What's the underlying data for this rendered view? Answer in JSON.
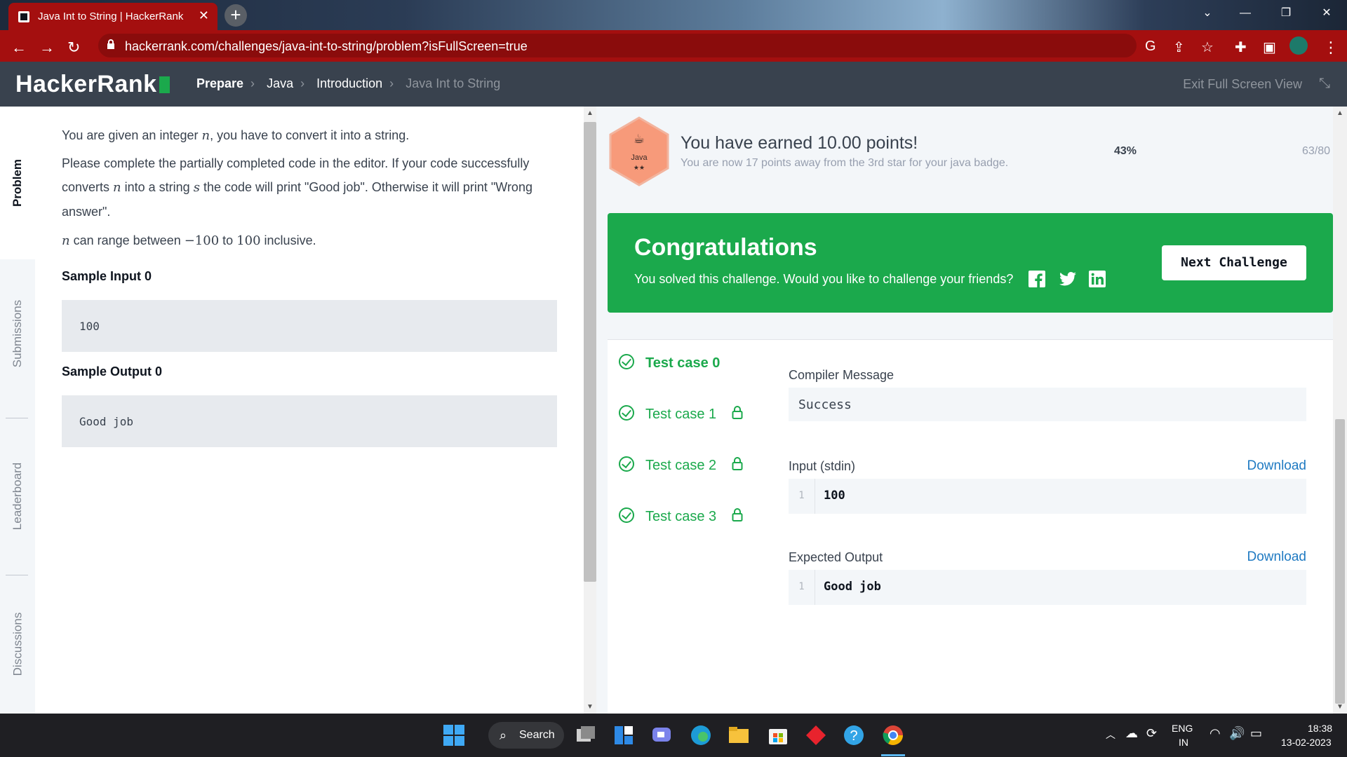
{
  "browser": {
    "tab_title": "Java Int to String | HackerRank",
    "url": "hackerrank.com/challenges/java-int-to-string/problem?isFullScreen=true",
    "tab_color": "#a40f0f"
  },
  "header": {
    "logo": "HackerRank",
    "breadcrumbs": [
      "Prepare",
      "Java",
      "Introduction",
      "Java Int to String"
    ],
    "exit_fullscreen": "Exit Full Screen View"
  },
  "sidebar": {
    "tabs": [
      "Problem",
      "Submissions",
      "Leaderboard",
      "Discussions"
    ],
    "active": "Problem"
  },
  "problem": {
    "line1_a": "You are given an integer ",
    "var_n": "n",
    "line1_b": ", you have to convert it into a string.",
    "line2_a": "Please complete the partially completed code in the editor. If your code successfully converts ",
    "line2_b": " into a string ",
    "var_s": "s",
    "line2_c": " the code will print \"Good job\". Otherwise it will print \"Wrong answer\".",
    "line3_a": " can range between ",
    "range_low": "−100",
    "line3_b": " to ",
    "range_high": "100",
    "line3_c": " inclusive.",
    "sample_input_title": "Sample Input 0",
    "sample_input": "100",
    "sample_output_title": "Sample Output 0",
    "sample_output": "Good job"
  },
  "achievement": {
    "badge_label": "Java",
    "badge_stars": "★★",
    "earned": "You have earned 10.00 points!",
    "away": "You are now 17 points away from the 3rd star for your java badge.",
    "percent": "43%",
    "progress_value": 0.43,
    "fraction": "63/80"
  },
  "congrats": {
    "title": "Congratulations",
    "subtitle": "You solved this challenge. Would you like to challenge your friends?",
    "next_button": "Next Challenge",
    "social": [
      "facebook-icon",
      "twitter-icon",
      "linkedin-icon"
    ]
  },
  "results": {
    "test_cases": [
      "Test case 0",
      "Test case 1",
      "Test case 2",
      "Test case 3"
    ],
    "compiler_label": "Compiler Message",
    "compiler_message": "Success",
    "input_label": "Input (stdin)",
    "input_line_no": "1",
    "input_value": "100",
    "expected_label": "Expected Output",
    "expected_line_no": "1",
    "expected_value": "Good job",
    "download": "Download"
  },
  "taskbar": {
    "search": "Search",
    "lang": "ENG",
    "region": "IN",
    "time": "18:38",
    "date": "13-02-2023"
  },
  "colors": {
    "success_green": "#1ba94c",
    "header_dark": "#39424e",
    "link_blue": "#1f7ac2",
    "badge_orange": "#f79a7a"
  }
}
